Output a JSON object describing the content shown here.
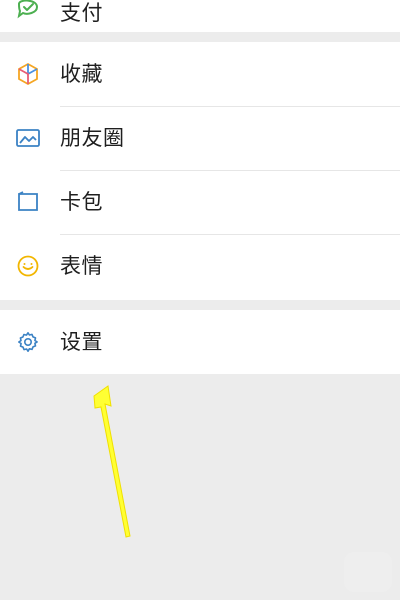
{
  "menu": {
    "top_item": {
      "label": "支付",
      "icon": "pay-icon"
    },
    "items": [
      {
        "label": "收藏",
        "icon": "favorites-icon"
      },
      {
        "label": "朋友圈",
        "icon": "moments-icon"
      },
      {
        "label": "卡包",
        "icon": "card-wallet-icon"
      },
      {
        "label": "表情",
        "icon": "sticker-icon"
      }
    ],
    "settings": {
      "label": "设置",
      "icon": "settings-icon"
    }
  },
  "annotation": {
    "arrow_color": "#ffff33",
    "icon_colors": {
      "pay": "#4caf50",
      "favorites_orange": "#f5a623",
      "favorites_blue": "#4a90e2",
      "favorites_red": "#e85d75",
      "moments_blue": "#3b82c4",
      "card_blue": "#3b82c4",
      "sticker_yellow": "#f2b600",
      "settings_blue": "#3b82c4"
    }
  }
}
